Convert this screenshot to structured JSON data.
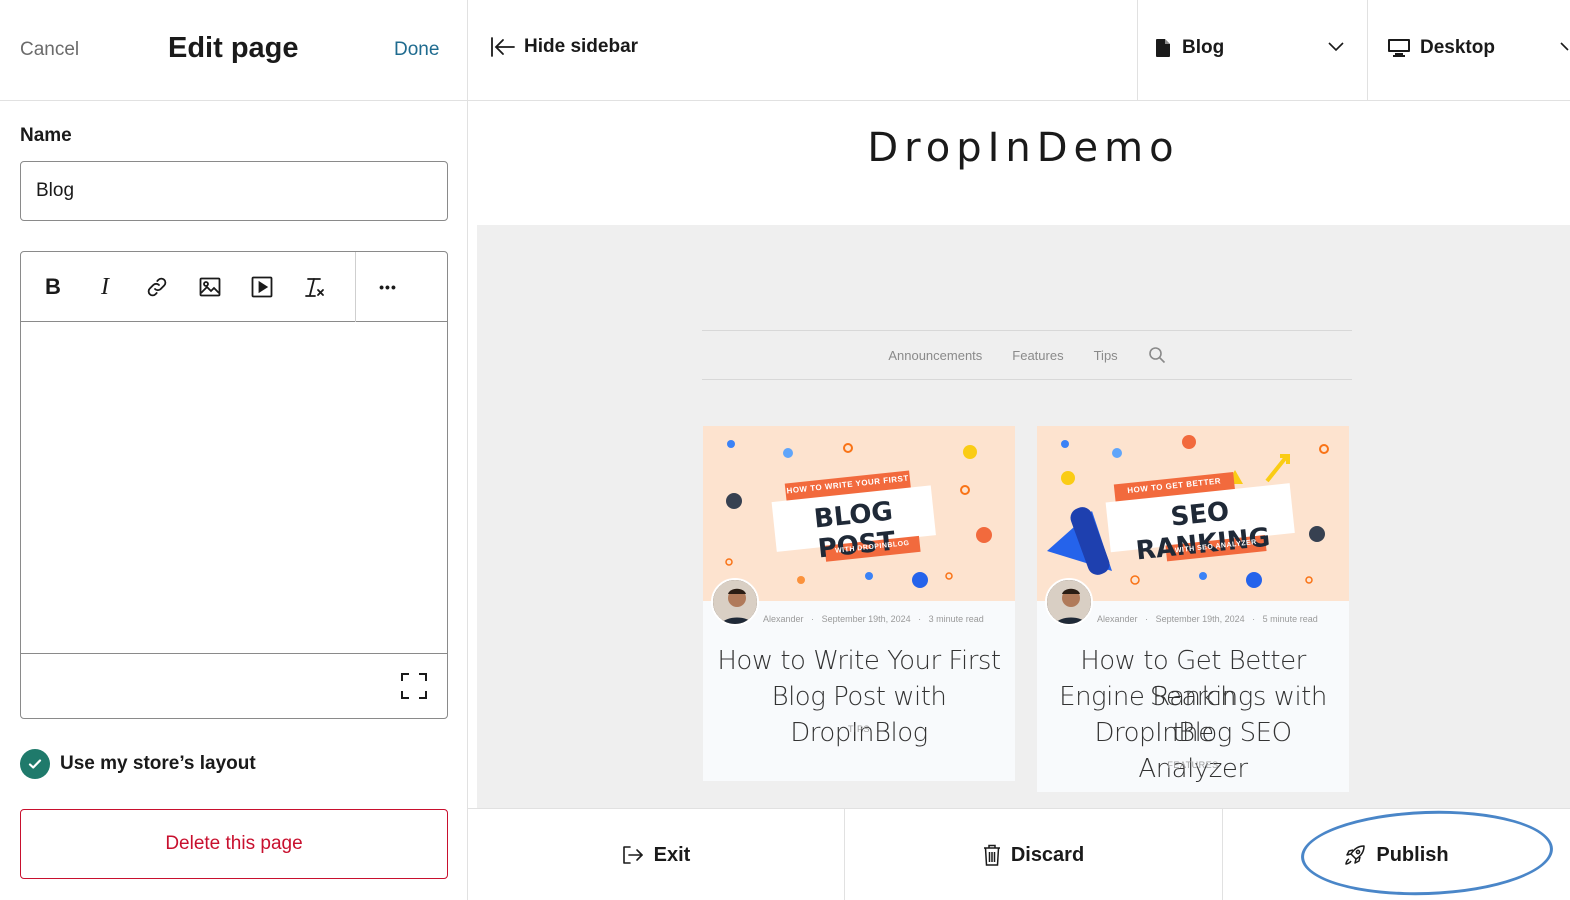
{
  "sidebar": {
    "cancel_label": "Cancel",
    "title": "Edit page",
    "done_label": "Done",
    "name_label": "Name",
    "name_value": "Blog",
    "toolbar": {
      "bold": "B",
      "italic": "I",
      "more": "•••"
    },
    "use_layout_label": "Use my store’s layout",
    "use_layout_checked": true,
    "delete_label": "Delete this page"
  },
  "topbar": {
    "hide_sidebar_label": "Hide sidebar",
    "page_select_label": "Blog",
    "device_select_label": "Desktop"
  },
  "preview": {
    "store_name": "DropInDemo",
    "blog_nav": [
      "Announcements",
      "Features",
      "Tips"
    ],
    "cards": [
      {
        "image_kicker": "HOW TO WRITE YOUR FIRST",
        "image_headline": "BLOG POST",
        "image_sub": "WITH DROPINBLOG",
        "author": "Alexander",
        "date": "September 19th, 2024",
        "read_time": "3 minute read",
        "title_line1": "How to Write Your First",
        "title_line2": "Blog Post with DropInBlog",
        "category": "TIPS"
      },
      {
        "image_kicker": "HOW TO GET BETTER",
        "image_headline": "SEO RANKING",
        "image_sub": "WITH SEO ANALYZER",
        "author": "Alexander",
        "date": "September 19th, 2024",
        "read_time": "5 minute read",
        "title_line1": "How to Get Better Search",
        "title_line2": "Engine Rankings with the",
        "title_line3": "DropInBlog SEO Analyzer",
        "category": "FEATURES"
      }
    ]
  },
  "bottombar": {
    "exit_label": "Exit",
    "discard_label": "Discard",
    "publish_label": "Publish"
  },
  "colors": {
    "accent_teal": "#1f7a6b",
    "link_blue": "#1f6b8f",
    "danger_red": "#c8102e",
    "highlight_ring": "#4a86c8",
    "card_image_bg": "#fde3cf",
    "banner_orange": "#f26a3d"
  }
}
